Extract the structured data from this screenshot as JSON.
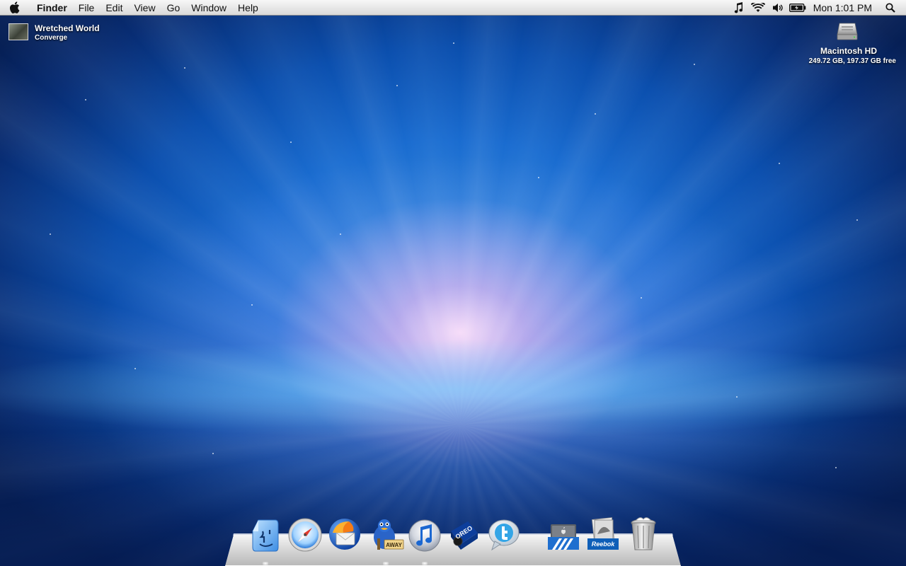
{
  "menubar": {
    "app_name": "Finder",
    "menus": [
      "File",
      "Edit",
      "View",
      "Go",
      "Window",
      "Help"
    ],
    "status_icons": [
      "music-note-icon",
      "wifi-icon",
      "volume-icon",
      "battery-icon"
    ],
    "clock": "Mon 1:01 PM"
  },
  "now_playing": {
    "title": "Wretched World",
    "artist": "Converge"
  },
  "desktop": {
    "drive": {
      "name": "Macintosh HD",
      "info": "249.72 GB, 197.37 GB free"
    }
  },
  "dock": {
    "items": [
      {
        "name": "Finder",
        "icon": "finder-icon",
        "running": true
      },
      {
        "name": "Safari",
        "icon": "safari-compass-icon",
        "running": false
      },
      {
        "name": "Thunderbird",
        "icon": "thunderbird-icon",
        "running": false
      },
      {
        "name": "Adium",
        "icon": "adium-duck-away-icon",
        "badge": "AWAY",
        "running": true
      },
      {
        "name": "iTunes",
        "icon": "itunes-icon",
        "running": true
      },
      {
        "name": "Oreo",
        "icon": "oreo-box-icon",
        "badge": "OREO",
        "running": false
      },
      {
        "name": "Twitter",
        "icon": "twitter-bubble-icon",
        "running": false
      },
      {
        "name": "Applications",
        "icon": "applications-stack-icon",
        "running": false
      },
      {
        "name": "Documents",
        "icon": "reebok-stack-icon",
        "badge": "Reebok",
        "running": false
      },
      {
        "name": "Trash",
        "icon": "trash-icon",
        "running": false
      }
    ]
  }
}
